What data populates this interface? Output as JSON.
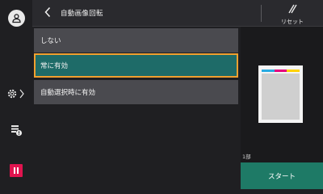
{
  "header": {
    "title": "自動画像回転",
    "reset_label": "リセット"
  },
  "options": [
    {
      "label": "しない",
      "selected": false
    },
    {
      "label": "常に有効",
      "selected": true
    },
    {
      "label": "自動選択時に有効",
      "selected": false
    }
  ],
  "preview": {
    "copies": "1部",
    "stripe_colors": [
      "#29abe2",
      "#e6007e",
      "#ffd200"
    ]
  },
  "start_label": "スタート",
  "left_rail": {
    "icons": [
      "user-icon",
      "gear-icon",
      "job-status-icon",
      "stop-icon"
    ]
  },
  "colors": {
    "selected_bg": "#1e6b68",
    "selected_border": "#f0a030",
    "start_bg": "#1e7a66",
    "stop_red": "#e0144f"
  }
}
